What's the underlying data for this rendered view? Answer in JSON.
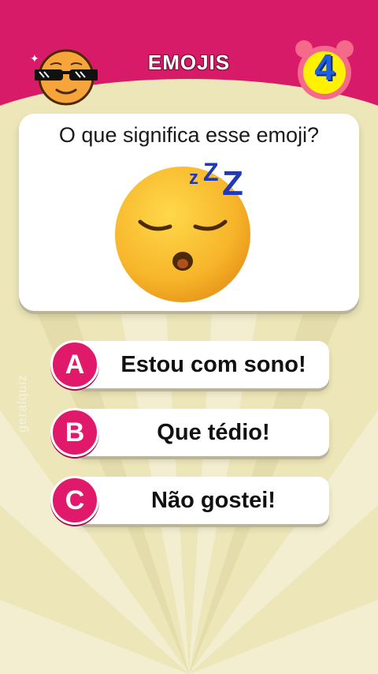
{
  "header": {
    "title": "EMOJIS",
    "timer_value": "4"
  },
  "question": {
    "text": "O que significa esse emoji?",
    "emoji_icon": "sleeping-face-icon"
  },
  "answers": [
    {
      "letter": "A",
      "text": "Estou com sono!"
    },
    {
      "letter": "B",
      "text": "Que tédio!"
    },
    {
      "letter": "C",
      "text": "Não gostei!"
    }
  ],
  "watermark": "geralquiz",
  "colors": {
    "brand": "#d81b68",
    "background": "#ece6b8",
    "timer": "#1e5fe0"
  }
}
